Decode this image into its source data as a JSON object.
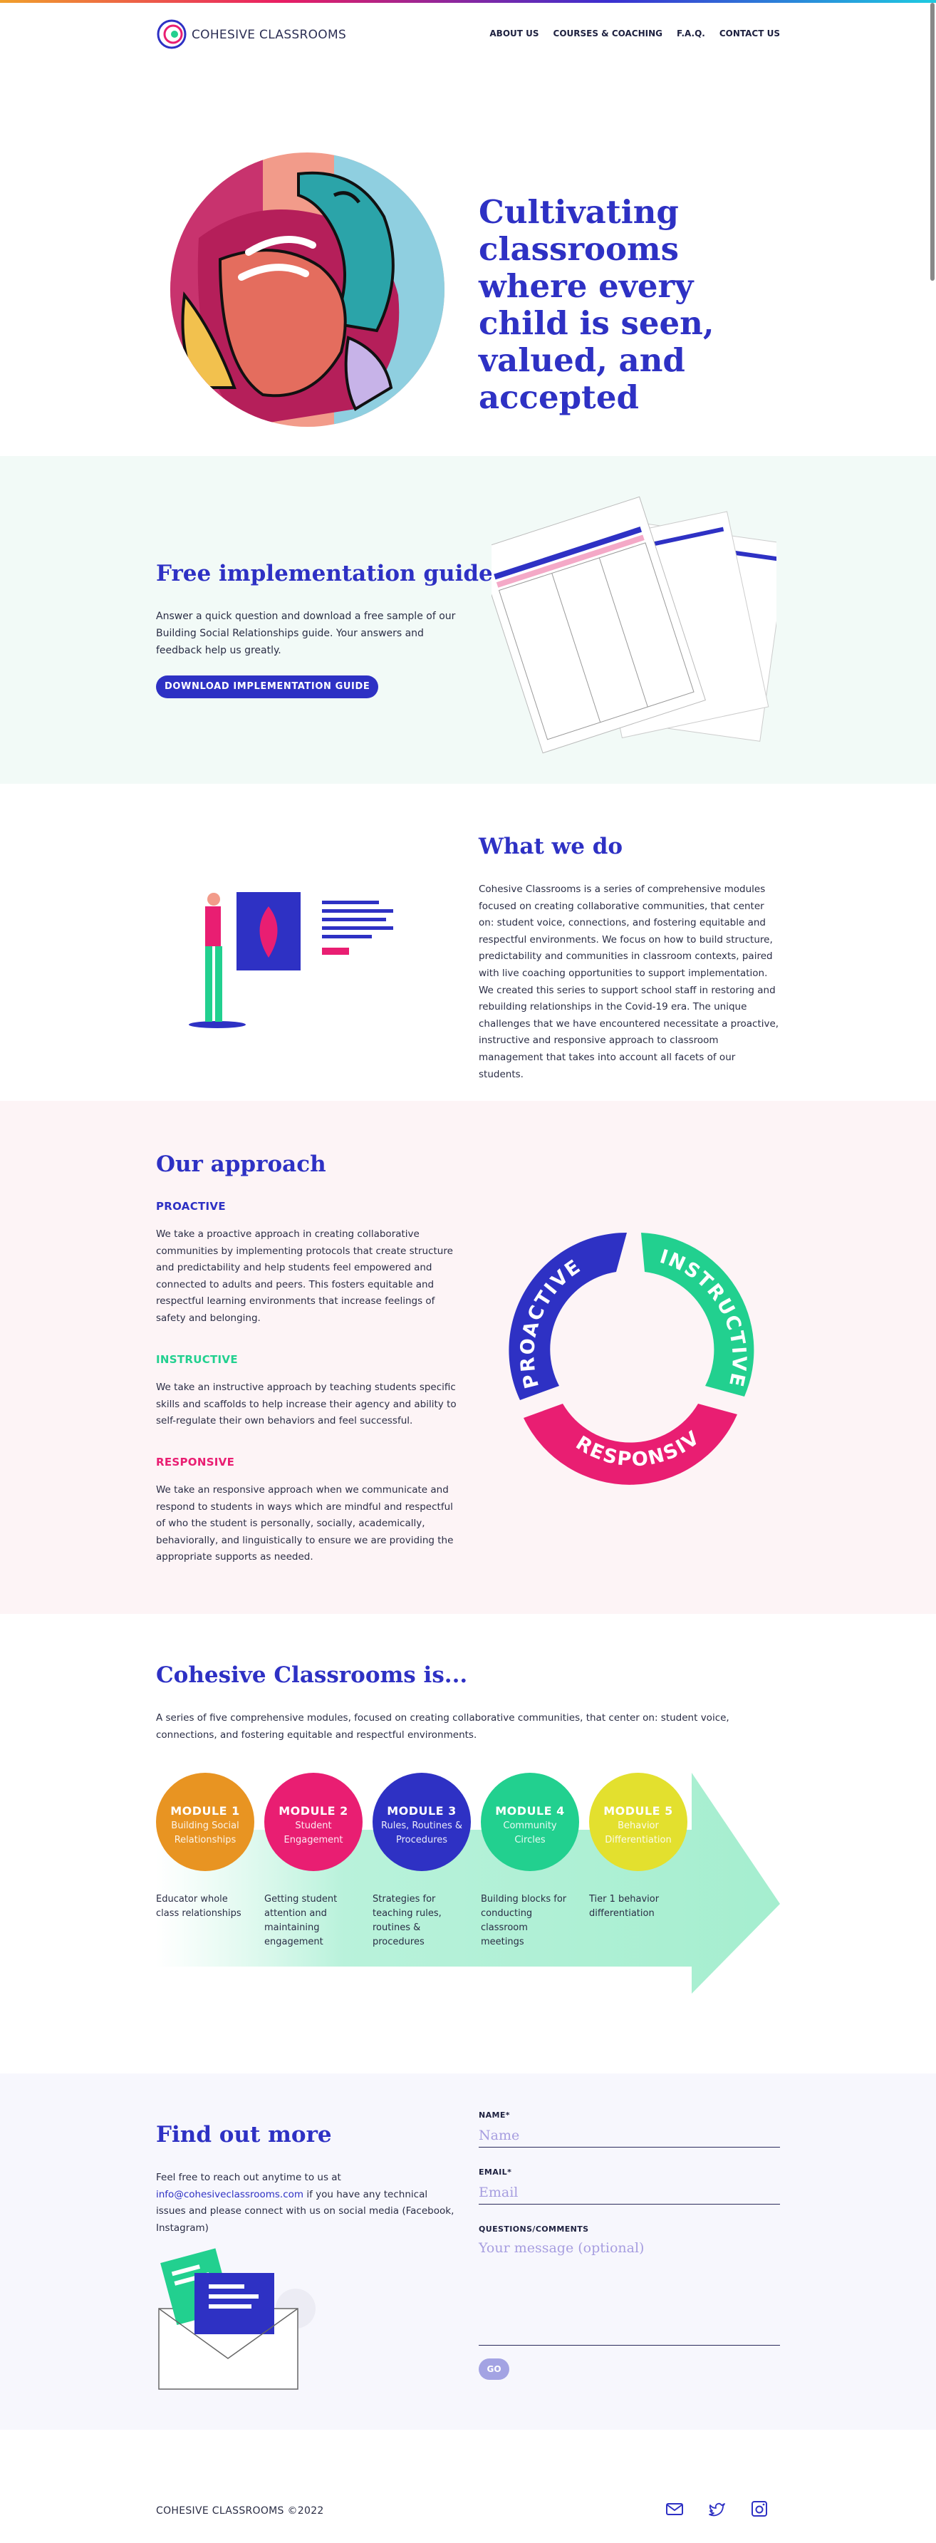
{
  "brand": "COHESIVE CLASSROOMS",
  "nav": {
    "about": "ABOUT US",
    "courses": "COURSES & COACHING",
    "faq": "F.A.Q.",
    "contact": "CONTACT US"
  },
  "hero": {
    "title": "Cultivating classrooms where every child is seen, valued, and accepted"
  },
  "guide": {
    "title": "Free implementation guide",
    "text": "Answer a quick question and download a free sample of our Building Social Relationships guide. Your answers and feedback help us greatly.",
    "button": "DOWNLOAD IMPLEMENTATION GUIDE"
  },
  "what": {
    "title": "What we do",
    "text": "Cohesive Classrooms is a series of comprehensive modules focused on creating collaborative communities, that center on: student voice, connections, and fostering equitable and respectful environments. We focus on how to build structure, predictability and communities in classroom contexts, paired with live coaching opportunities to support implementation. We created this series to support school staff in restoring and rebuilding relationships in the Covid-19 era. The unique challenges that we have encountered necessitate a proactive, instructive and responsive approach to classroom management that takes into account all facets of our students."
  },
  "approach": {
    "title": "Our approach",
    "items": [
      {
        "label": "PROACTIVE",
        "text": "We take a proactive approach in creating collaborative communities by implementing protocols that create structure and predictability and help students feel empowered and connected to adults and peers. This fosters equitable and respectful learning environments that increase feelings of safety and belonging."
      },
      {
        "label": "INSTRUCTIVE",
        "text": "We take an instructive approach by teaching students specific skills and scaffolds to help increase their agency and ability to self-regulate their own behaviors and feel successful."
      },
      {
        "label": "RESPONSIVE",
        "text": "We take an responsive approach when we communicate and respond to students in ways which are mindful and respectful of who the student is personally, socially, academically, behaviorally, and linguistically to ensure we are providing the appropriate supports as needed."
      }
    ],
    "cycle": [
      "PROACTIVE",
      "INSTRUCTIVE",
      "RESPONSIVE"
    ]
  },
  "is": {
    "title": "Cohesive Classrooms is...",
    "text": "A series of five comprehensive modules, focused on creating collaborative communities, that center on: student voice, connections, and fostering equitable and respectful environments.",
    "modules": [
      {
        "title": "MODULE 1",
        "sub": "Building Social Relationships",
        "desc": "Educator whole class relationships",
        "color": "#e89422"
      },
      {
        "title": "MODULE 2",
        "sub": "Student Engagement",
        "desc": "Getting student attention and maintaining engagement",
        "color": "#e91e72"
      },
      {
        "title": "MODULE 3",
        "sub": "Rules, Routines & Procedures",
        "desc": "Strategies for teaching rules, routines & procedures",
        "color": "#2e31c4"
      },
      {
        "title": "MODULE 4",
        "sub": "Community Circles",
        "desc": "Building blocks for conducting classroom meetings",
        "color": "#22d08f"
      },
      {
        "title": "MODULE 5",
        "sub": "Behavior Differentiation",
        "desc": "Tier 1 behavior differentiation",
        "color": "#e3e02e"
      }
    ]
  },
  "contact": {
    "title": "Find out more",
    "text_before": "Feel free to reach out anytime to us at",
    "email": "info@cohesiveclassrooms.com",
    "text_after": "if you have any technical issues and please connect with us on social media (Facebook, Instagram)",
    "name_label": "NAME*",
    "name_placeholder": "Name",
    "email_label": "EMAIL*",
    "email_placeholder": "Email",
    "comments_label": "QUESTIONS/COMMENTS",
    "comments_placeholder": "Your message (optional)",
    "go": "GO"
  },
  "footer": {
    "copyright": "COHESIVE CLASSROOMS ©2022"
  },
  "icons": {
    "mail": "mail-icon",
    "twitter": "twitter-icon",
    "instagram": "instagram-icon"
  }
}
